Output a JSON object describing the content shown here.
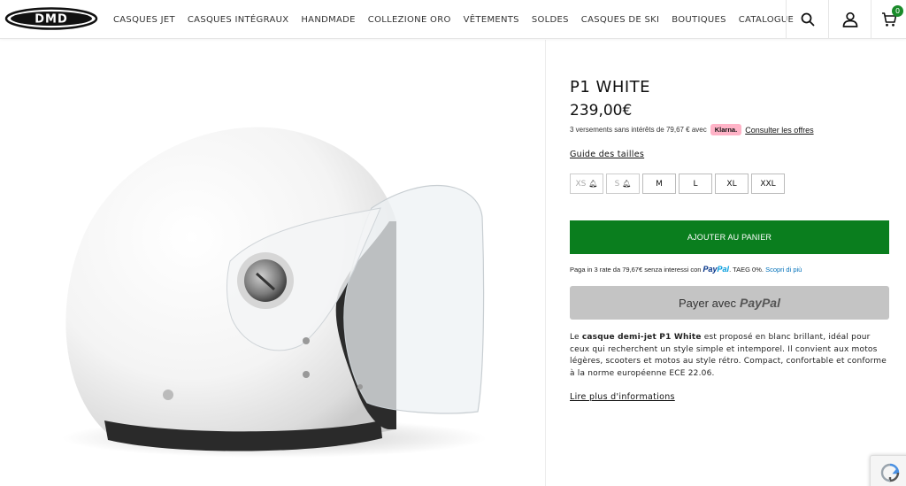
{
  "brand": {
    "logo_text": "DMD"
  },
  "nav": {
    "items": [
      "CASQUES JET",
      "CASQUES INTÉGRAUX",
      "HANDMADE",
      "COLLEZIONE ORO",
      "VÊTEMENTS",
      "SOLDES",
      "CASQUES DE SKI",
      "BOUTIQUES",
      "CATALOGUE"
    ]
  },
  "header": {
    "cart_count": "0",
    "icons": [
      "search-icon",
      "account-icon",
      "cart-icon"
    ]
  },
  "product": {
    "title": "P1 WHITE",
    "price": "239,00€",
    "klarna": {
      "text": "3 versements sans intérêts de 79,67 € avec",
      "badge": "Klarna.",
      "link": "Consulter les offres"
    },
    "size_guide": "Guide des tailles",
    "sizes": [
      {
        "label": "XS",
        "available": false
      },
      {
        "label": "S",
        "available": false
      },
      {
        "label": "M",
        "available": true
      },
      {
        "label": "L",
        "available": true
      },
      {
        "label": "XL",
        "available": true
      },
      {
        "label": "XXL",
        "available": true
      }
    ],
    "add_to_cart": "AJOUTER AU PANIER",
    "paypal_offer": {
      "text": "Paga in 3 rate da 79,67€ senza interessi con",
      "brand_pay": "Pay",
      "brand_pal": "Pal",
      "taeg": ". TAEG 0%.",
      "link": "Scopri di più"
    },
    "paypal_button": {
      "prefix": "Payer avec",
      "brand": "PayPal"
    },
    "description": {
      "p1": "Le ",
      "bold": "casque demi-jet P1 White",
      "p2": " est proposé en blanc brillant, idéal pour ceux qui recherchent un style simple et intemporel. Il convient aux motos légères, scooters et motos au style rétro. Compact, confortable et conforme à la norme européenne ECE 22.06."
    },
    "read_more": "Lire plus d'informations"
  },
  "colors": {
    "add_to_cart_bg": "#0a7e1e",
    "paypal_button_bg": "#c4c4c4",
    "klarna_pink": "#ffb3c7",
    "cart_badge": "#1a8a2a"
  }
}
